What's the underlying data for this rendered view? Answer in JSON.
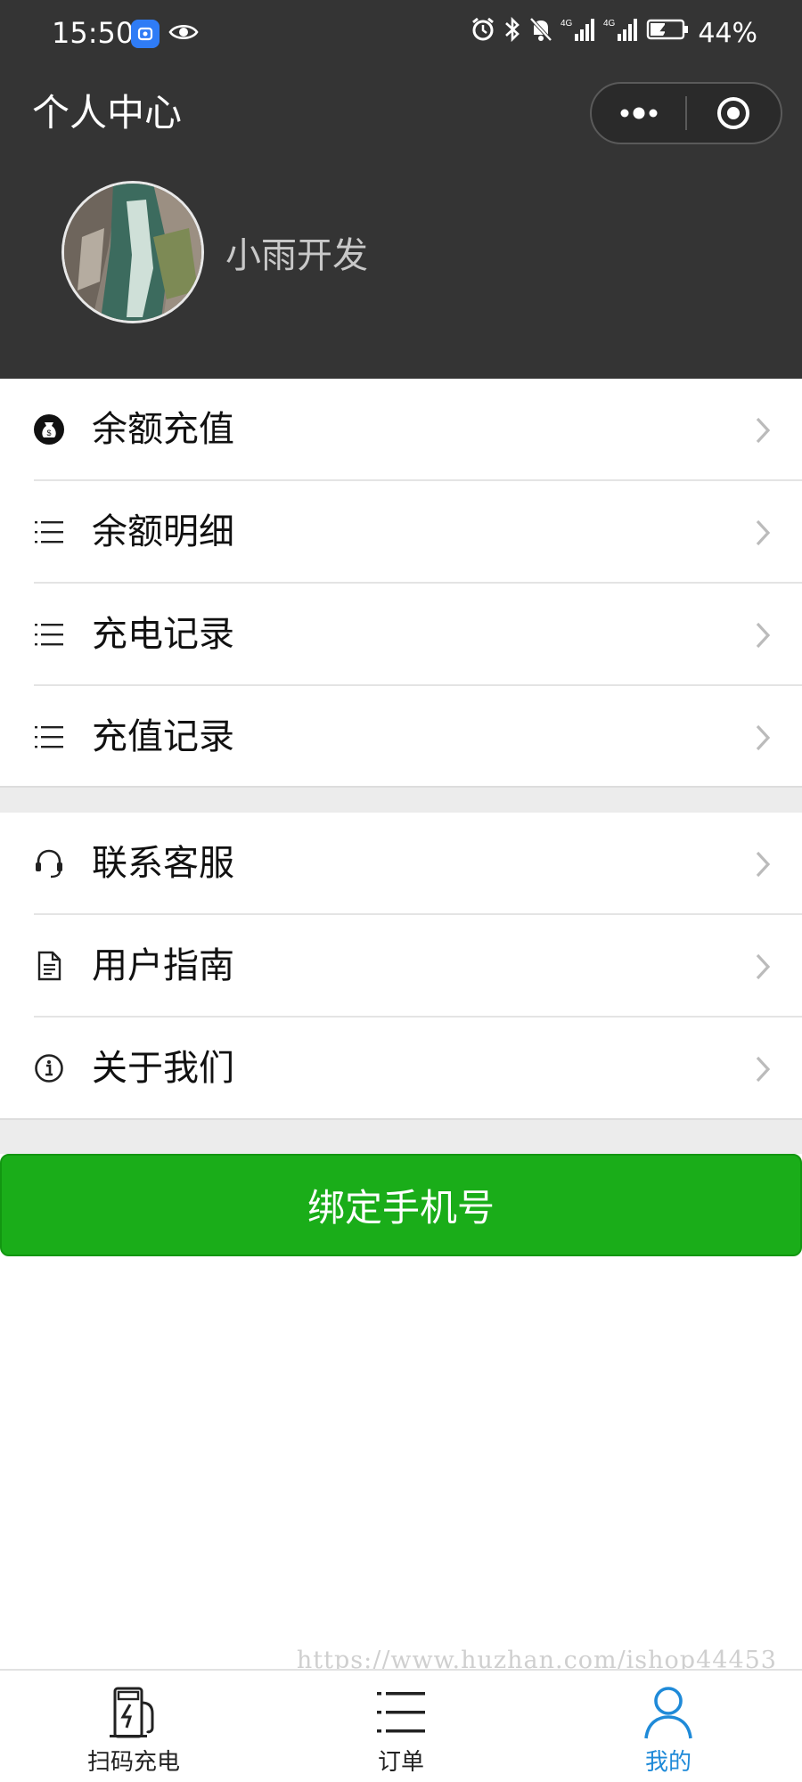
{
  "status_bar": {
    "time": "15:50",
    "battery": "44%"
  },
  "nav": {
    "title": "个人中心"
  },
  "profile": {
    "username": "小雨开发"
  },
  "menu": {
    "group1": [
      {
        "label": "余额充值",
        "icon": "money-bag-icon"
      },
      {
        "label": "余额明细",
        "icon": "list-icon"
      },
      {
        "label": "充电记录",
        "icon": "list-icon"
      },
      {
        "label": "充值记录",
        "icon": "list-icon"
      }
    ],
    "group2": [
      {
        "label": "联系客服",
        "icon": "headset-icon"
      },
      {
        "label": "用户指南",
        "icon": "document-icon"
      },
      {
        "label": "关于我们",
        "icon": "info-icon"
      }
    ]
  },
  "bind_button": {
    "label": "绑定手机号",
    "color": "#1aad19"
  },
  "watermark": "https://www.huzhan.com/ishop44453",
  "tabbar": {
    "items": [
      {
        "label": "扫码充电",
        "icon": "charger-icon",
        "active": false
      },
      {
        "label": "订单",
        "icon": "list-icon",
        "active": false
      },
      {
        "label": "我的",
        "icon": "user-icon",
        "active": true
      }
    ],
    "active_color": "#1f8ad8"
  },
  "colors": {
    "header_bg": "#343434",
    "separator": "#e4e4e4",
    "band": "#ececec"
  }
}
